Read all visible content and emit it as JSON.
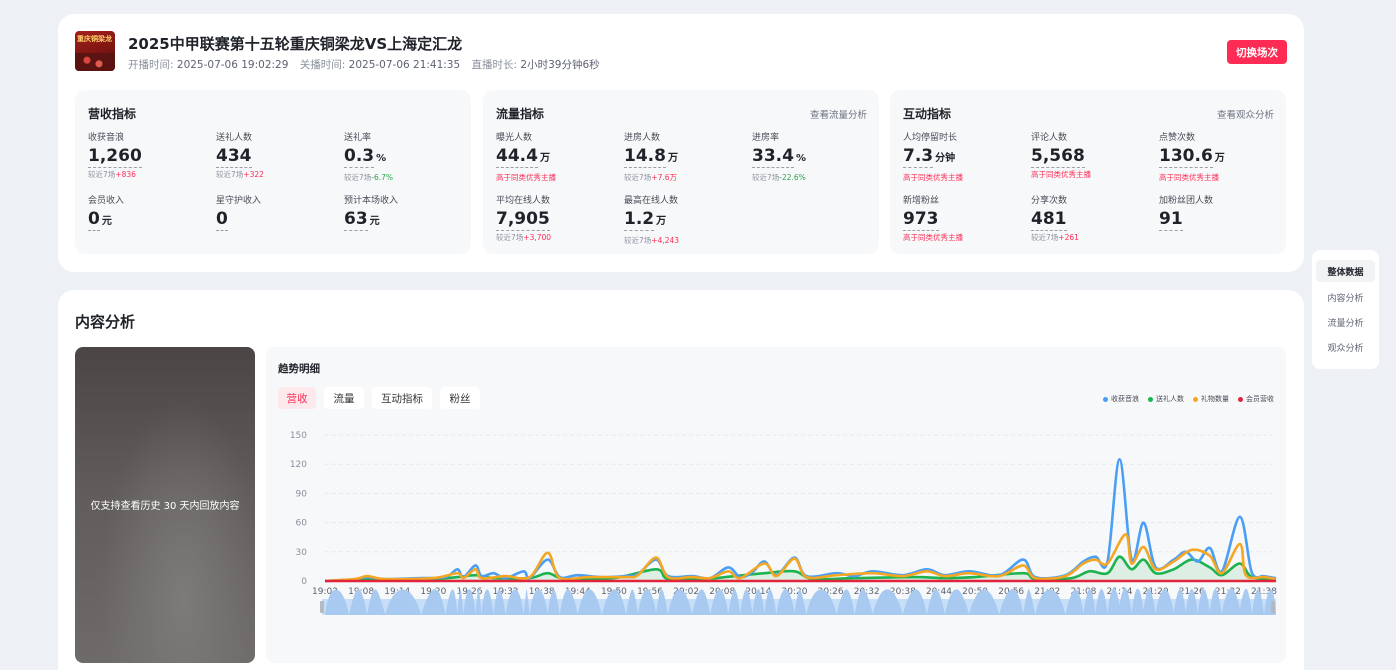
{
  "header": {
    "title": "2025中甲联赛第十五轮重庆铜梁龙VS上海定汇龙",
    "cover_text": "重庆铜梁龙",
    "start_label": "开播时间:",
    "start_time": "2025-07-06 19:02:29",
    "end_label": "关播时间:",
    "end_time": "2025-07-06 21:41:35",
    "duration_label": "直播时长:",
    "duration": "2小时39分钟6秒",
    "switch_button": "切换场次"
  },
  "revenue": {
    "title": "营收指标",
    "metrics": [
      {
        "label": "收获音浪",
        "value": "1,260",
        "unit": "",
        "cmp_prefix": "较近7场",
        "cmp_value": "+836",
        "trend": "up"
      },
      {
        "label": "送礼人数",
        "value": "434",
        "unit": "",
        "cmp_prefix": "较近7场",
        "cmp_value": "+322",
        "trend": "up"
      },
      {
        "label": "送礼率",
        "value": "0.3",
        "unit": "%",
        "cmp_prefix": "较近7场",
        "cmp_value": "-6.7%",
        "trend": "down"
      },
      {
        "label": "会员收入",
        "value": "0",
        "unit": "元"
      },
      {
        "label": "星守护收入",
        "value": "0",
        "unit": ""
      },
      {
        "label": "预计本场收入",
        "value": "63",
        "unit": "元"
      }
    ]
  },
  "traffic": {
    "title": "流量指标",
    "link": "查看流量分析",
    "metrics": [
      {
        "label": "曝光人数",
        "value": "44.4",
        "unit": "万",
        "tag": "高于同类优秀主播"
      },
      {
        "label": "进房人数",
        "value": "14.8",
        "unit": "万",
        "cmp_prefix": "较近7场",
        "cmp_value": "+7.6万",
        "trend": "up"
      },
      {
        "label": "进房率",
        "value": "33.4",
        "unit": "%",
        "cmp_prefix": "较近7场",
        "cmp_value": "-22.6%",
        "trend": "down"
      },
      {
        "label": "平均在线人数",
        "value": "7,905",
        "unit": "",
        "cmp_prefix": "较近7场",
        "cmp_value": "+3,700",
        "trend": "up"
      },
      {
        "label": "最高在线人数",
        "value": "1.2",
        "unit": "万",
        "cmp_prefix": "较近7场",
        "cmp_value": "+4,243",
        "trend": "up"
      }
    ]
  },
  "interaction": {
    "title": "互动指标",
    "link": "查看观众分析",
    "metrics": [
      {
        "label": "人均停留时长",
        "value": "7.3",
        "unit": "分钟",
        "tag": "高于同类优秀主播"
      },
      {
        "label": "评论人数",
        "value": "5,568",
        "unit": "",
        "tag": "高于同类优秀主播"
      },
      {
        "label": "点赞次数",
        "value": "130.6",
        "unit": "万",
        "tag": "高于同类优秀主播"
      },
      {
        "label": "新增粉丝",
        "value": "973",
        "unit": "",
        "tag": "高于同类优秀主播"
      },
      {
        "label": "分享次数",
        "value": "481",
        "unit": "",
        "cmp_prefix": "较近7场",
        "cmp_value": "+261",
        "trend": "up"
      },
      {
        "label": "加粉丝团人数",
        "value": "91",
        "unit": ""
      }
    ]
  },
  "side_nav": {
    "items": [
      "整体数据",
      "内容分析",
      "流量分析",
      "观众分析"
    ],
    "active": 0
  },
  "content": {
    "title": "内容分析",
    "video_message": "仅支持查看历史 30 天内回放内容",
    "trend_title": "趋势明细",
    "tabs": [
      "营收",
      "流量",
      "互动指标",
      "粉丝"
    ],
    "active_tab": 0
  },
  "colors": {
    "accent": "#fe2c55",
    "series_blue": "#4a9ff5",
    "series_green": "#1db34f",
    "series_orange": "#f5a623",
    "series_red": "#e0243c"
  },
  "chart_data": {
    "type": "line",
    "ylim": [
      0,
      150
    ],
    "yticks": [
      0,
      30,
      60,
      90,
      120,
      150
    ],
    "x_tick_labels": [
      "19:02",
      "19:08",
      "19:14",
      "19:20",
      "19:26",
      "19:32",
      "19:38",
      "19:44",
      "19:50",
      "19:56",
      "20:02",
      "20:08",
      "20:14",
      "20:20",
      "20:26",
      "20:32",
      "20:38",
      "20:44",
      "20:50",
      "20:56",
      "21:02",
      "21:08",
      "21:14",
      "21:20",
      "21:26",
      "21:32",
      "21:38"
    ],
    "x_start": "19:02",
    "x_end": "21:40",
    "series": [
      {
        "name": "收获音浪",
        "color": "#4a9ff5",
        "points": [
          [
            "19:02",
            0
          ],
          [
            "19:06",
            1
          ],
          [
            "19:09",
            4
          ],
          [
            "19:12",
            2
          ],
          [
            "19:18",
            3
          ],
          [
            "19:22",
            4
          ],
          [
            "19:24",
            12
          ],
          [
            "19:25",
            4
          ],
          [
            "19:27",
            16
          ],
          [
            "19:28",
            5
          ],
          [
            "19:30",
            8
          ],
          [
            "19:32",
            3
          ],
          [
            "19:35",
            10
          ],
          [
            "19:36",
            3
          ],
          [
            "19:39",
            22
          ],
          [
            "19:41",
            4
          ],
          [
            "19:44",
            6
          ],
          [
            "19:48",
            4
          ],
          [
            "19:52",
            5
          ],
          [
            "19:54",
            7
          ],
          [
            "19:57",
            22
          ],
          [
            "19:59",
            5
          ],
          [
            "20:03",
            5
          ],
          [
            "20:06",
            3
          ],
          [
            "20:09",
            14
          ],
          [
            "20:11",
            4
          ],
          [
            "20:13",
            9
          ],
          [
            "20:15",
            20
          ],
          [
            "20:17",
            6
          ],
          [
            "20:20",
            24
          ],
          [
            "20:22",
            5
          ],
          [
            "20:27",
            8
          ],
          [
            "20:30",
            5
          ],
          [
            "20:33",
            10
          ],
          [
            "20:38",
            6
          ],
          [
            "20:42",
            12
          ],
          [
            "20:45",
            6
          ],
          [
            "20:49",
            10
          ],
          [
            "20:54",
            6
          ],
          [
            "20:58",
            22
          ],
          [
            "21:00",
            4
          ],
          [
            "21:05",
            6
          ],
          [
            "21:08",
            20
          ],
          [
            "21:10",
            25
          ],
          [
            "21:12",
            20
          ],
          [
            "21:14",
            125
          ],
          [
            "21:16",
            22
          ],
          [
            "21:18",
            60
          ],
          [
            "21:20",
            14
          ],
          [
            "21:23",
            22
          ],
          [
            "21:25",
            30
          ],
          [
            "21:27",
            20
          ],
          [
            "21:29",
            34
          ],
          [
            "21:31",
            10
          ],
          [
            "21:34",
            66
          ],
          [
            "21:36",
            8
          ],
          [
            "21:38",
            5
          ],
          [
            "21:40",
            3
          ]
        ]
      },
      {
        "name": "送礼人数",
        "color": "#1db34f",
        "points": [
          [
            "19:02",
            0
          ],
          [
            "19:09",
            2
          ],
          [
            "19:12",
            1
          ],
          [
            "19:20",
            2
          ],
          [
            "19:24",
            4
          ],
          [
            "19:27",
            6
          ],
          [
            "19:30",
            3
          ],
          [
            "19:36",
            3
          ],
          [
            "19:39",
            8
          ],
          [
            "19:42",
            2
          ],
          [
            "19:50",
            3
          ],
          [
            "19:57",
            12
          ],
          [
            "19:59",
            2
          ],
          [
            "20:05",
            2
          ],
          [
            "20:10",
            5
          ],
          [
            "20:15",
            8
          ],
          [
            "20:20",
            10
          ],
          [
            "20:23",
            2
          ],
          [
            "20:30",
            3
          ],
          [
            "20:40",
            4
          ],
          [
            "20:45",
            3
          ],
          [
            "20:50",
            4
          ],
          [
            "20:58",
            8
          ],
          [
            "21:00",
            2
          ],
          [
            "21:06",
            3
          ],
          [
            "21:09",
            10
          ],
          [
            "21:12",
            8
          ],
          [
            "21:14",
            25
          ],
          [
            "21:16",
            12
          ],
          [
            "21:18",
            22
          ],
          [
            "21:20",
            8
          ],
          [
            "21:23",
            12
          ],
          [
            "21:26",
            22
          ],
          [
            "21:29",
            14
          ],
          [
            "21:31",
            6
          ],
          [
            "21:34",
            18
          ],
          [
            "21:36",
            4
          ],
          [
            "21:40",
            2
          ]
        ]
      },
      {
        "name": "礼物数量",
        "color": "#f5a623",
        "points": [
          [
            "19:02",
            0
          ],
          [
            "19:07",
            2
          ],
          [
            "19:09",
            5
          ],
          [
            "19:12",
            2
          ],
          [
            "19:20",
            3
          ],
          [
            "19:24",
            8
          ],
          [
            "19:25",
            3
          ],
          [
            "19:27",
            12
          ],
          [
            "19:28",
            3
          ],
          [
            "19:32",
            5
          ],
          [
            "19:36",
            4
          ],
          [
            "19:39",
            29
          ],
          [
            "19:41",
            3
          ],
          [
            "19:46",
            4
          ],
          [
            "19:52",
            4
          ],
          [
            "19:54",
            6
          ],
          [
            "19:57",
            24
          ],
          [
            "19:59",
            4
          ],
          [
            "20:03",
            4
          ],
          [
            "20:06",
            3
          ],
          [
            "20:09",
            10
          ],
          [
            "20:11",
            3
          ],
          [
            "20:15",
            18
          ],
          [
            "20:17",
            5
          ],
          [
            "20:20",
            23
          ],
          [
            "20:22",
            4
          ],
          [
            "20:27",
            6
          ],
          [
            "20:33",
            8
          ],
          [
            "20:38",
            5
          ],
          [
            "20:42",
            10
          ],
          [
            "20:45",
            5
          ],
          [
            "20:49",
            8
          ],
          [
            "20:54",
            5
          ],
          [
            "20:58",
            16
          ],
          [
            "21:00",
            3
          ],
          [
            "21:05",
            5
          ],
          [
            "21:08",
            18
          ],
          [
            "21:10",
            22
          ],
          [
            "21:12",
            18
          ],
          [
            "21:15",
            48
          ],
          [
            "21:16",
            18
          ],
          [
            "21:18",
            35
          ],
          [
            "21:20",
            12
          ],
          [
            "21:23",
            20
          ],
          [
            "21:26",
            32
          ],
          [
            "21:29",
            26
          ],
          [
            "21:31",
            8
          ],
          [
            "21:34",
            38
          ],
          [
            "21:35",
            6
          ],
          [
            "21:38",
            4
          ],
          [
            "21:40",
            2
          ]
        ]
      },
      {
        "name": "会员营收",
        "color": "#e0243c",
        "points": [
          [
            "19:02",
            0
          ],
          [
            "21:40",
            0
          ]
        ]
      }
    ]
  }
}
